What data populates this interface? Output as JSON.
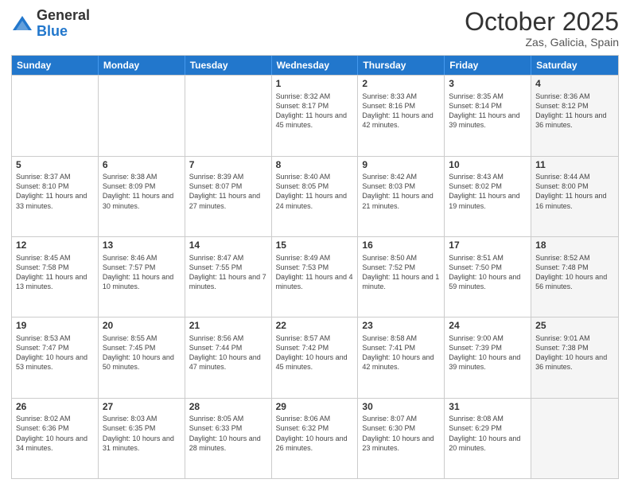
{
  "header": {
    "logo_general": "General",
    "logo_blue": "Blue",
    "title": "October 2025",
    "location": "Zas, Galicia, Spain"
  },
  "calendar": {
    "days_of_week": [
      "Sunday",
      "Monday",
      "Tuesday",
      "Wednesday",
      "Thursday",
      "Friday",
      "Saturday"
    ],
    "rows": [
      [
        {
          "day": "",
          "info": "",
          "shaded": false
        },
        {
          "day": "",
          "info": "",
          "shaded": false
        },
        {
          "day": "",
          "info": "",
          "shaded": false
        },
        {
          "day": "1",
          "info": "Sunrise: 8:32 AM\nSunset: 8:17 PM\nDaylight: 11 hours\nand 45 minutes.",
          "shaded": false
        },
        {
          "day": "2",
          "info": "Sunrise: 8:33 AM\nSunset: 8:16 PM\nDaylight: 11 hours\nand 42 minutes.",
          "shaded": false
        },
        {
          "day": "3",
          "info": "Sunrise: 8:35 AM\nSunset: 8:14 PM\nDaylight: 11 hours\nand 39 minutes.",
          "shaded": false
        },
        {
          "day": "4",
          "info": "Sunrise: 8:36 AM\nSunset: 8:12 PM\nDaylight: 11 hours\nand 36 minutes.",
          "shaded": true
        }
      ],
      [
        {
          "day": "5",
          "info": "Sunrise: 8:37 AM\nSunset: 8:10 PM\nDaylight: 11 hours\nand 33 minutes.",
          "shaded": false
        },
        {
          "day": "6",
          "info": "Sunrise: 8:38 AM\nSunset: 8:09 PM\nDaylight: 11 hours\nand 30 minutes.",
          "shaded": false
        },
        {
          "day": "7",
          "info": "Sunrise: 8:39 AM\nSunset: 8:07 PM\nDaylight: 11 hours\nand 27 minutes.",
          "shaded": false
        },
        {
          "day": "8",
          "info": "Sunrise: 8:40 AM\nSunset: 8:05 PM\nDaylight: 11 hours\nand 24 minutes.",
          "shaded": false
        },
        {
          "day": "9",
          "info": "Sunrise: 8:42 AM\nSunset: 8:03 PM\nDaylight: 11 hours\nand 21 minutes.",
          "shaded": false
        },
        {
          "day": "10",
          "info": "Sunrise: 8:43 AM\nSunset: 8:02 PM\nDaylight: 11 hours\nand 19 minutes.",
          "shaded": false
        },
        {
          "day": "11",
          "info": "Sunrise: 8:44 AM\nSunset: 8:00 PM\nDaylight: 11 hours\nand 16 minutes.",
          "shaded": true
        }
      ],
      [
        {
          "day": "12",
          "info": "Sunrise: 8:45 AM\nSunset: 7:58 PM\nDaylight: 11 hours\nand 13 minutes.",
          "shaded": false
        },
        {
          "day": "13",
          "info": "Sunrise: 8:46 AM\nSunset: 7:57 PM\nDaylight: 11 hours\nand 10 minutes.",
          "shaded": false
        },
        {
          "day": "14",
          "info": "Sunrise: 8:47 AM\nSunset: 7:55 PM\nDaylight: 11 hours\nand 7 minutes.",
          "shaded": false
        },
        {
          "day": "15",
          "info": "Sunrise: 8:49 AM\nSunset: 7:53 PM\nDaylight: 11 hours\nand 4 minutes.",
          "shaded": false
        },
        {
          "day": "16",
          "info": "Sunrise: 8:50 AM\nSunset: 7:52 PM\nDaylight: 11 hours\nand 1 minute.",
          "shaded": false
        },
        {
          "day": "17",
          "info": "Sunrise: 8:51 AM\nSunset: 7:50 PM\nDaylight: 10 hours\nand 59 minutes.",
          "shaded": false
        },
        {
          "day": "18",
          "info": "Sunrise: 8:52 AM\nSunset: 7:48 PM\nDaylight: 10 hours\nand 56 minutes.",
          "shaded": true
        }
      ],
      [
        {
          "day": "19",
          "info": "Sunrise: 8:53 AM\nSunset: 7:47 PM\nDaylight: 10 hours\nand 53 minutes.",
          "shaded": false
        },
        {
          "day": "20",
          "info": "Sunrise: 8:55 AM\nSunset: 7:45 PM\nDaylight: 10 hours\nand 50 minutes.",
          "shaded": false
        },
        {
          "day": "21",
          "info": "Sunrise: 8:56 AM\nSunset: 7:44 PM\nDaylight: 10 hours\nand 47 minutes.",
          "shaded": false
        },
        {
          "day": "22",
          "info": "Sunrise: 8:57 AM\nSunset: 7:42 PM\nDaylight: 10 hours\nand 45 minutes.",
          "shaded": false
        },
        {
          "day": "23",
          "info": "Sunrise: 8:58 AM\nSunset: 7:41 PM\nDaylight: 10 hours\nand 42 minutes.",
          "shaded": false
        },
        {
          "day": "24",
          "info": "Sunrise: 9:00 AM\nSunset: 7:39 PM\nDaylight: 10 hours\nand 39 minutes.",
          "shaded": false
        },
        {
          "day": "25",
          "info": "Sunrise: 9:01 AM\nSunset: 7:38 PM\nDaylight: 10 hours\nand 36 minutes.",
          "shaded": true
        }
      ],
      [
        {
          "day": "26",
          "info": "Sunrise: 8:02 AM\nSunset: 6:36 PM\nDaylight: 10 hours\nand 34 minutes.",
          "shaded": false
        },
        {
          "day": "27",
          "info": "Sunrise: 8:03 AM\nSunset: 6:35 PM\nDaylight: 10 hours\nand 31 minutes.",
          "shaded": false
        },
        {
          "day": "28",
          "info": "Sunrise: 8:05 AM\nSunset: 6:33 PM\nDaylight: 10 hours\nand 28 minutes.",
          "shaded": false
        },
        {
          "day": "29",
          "info": "Sunrise: 8:06 AM\nSunset: 6:32 PM\nDaylight: 10 hours\nand 26 minutes.",
          "shaded": false
        },
        {
          "day": "30",
          "info": "Sunrise: 8:07 AM\nSunset: 6:30 PM\nDaylight: 10 hours\nand 23 minutes.",
          "shaded": false
        },
        {
          "day": "31",
          "info": "Sunrise: 8:08 AM\nSunset: 6:29 PM\nDaylight: 10 hours\nand 20 minutes.",
          "shaded": false
        },
        {
          "day": "",
          "info": "",
          "shaded": true
        }
      ]
    ]
  }
}
